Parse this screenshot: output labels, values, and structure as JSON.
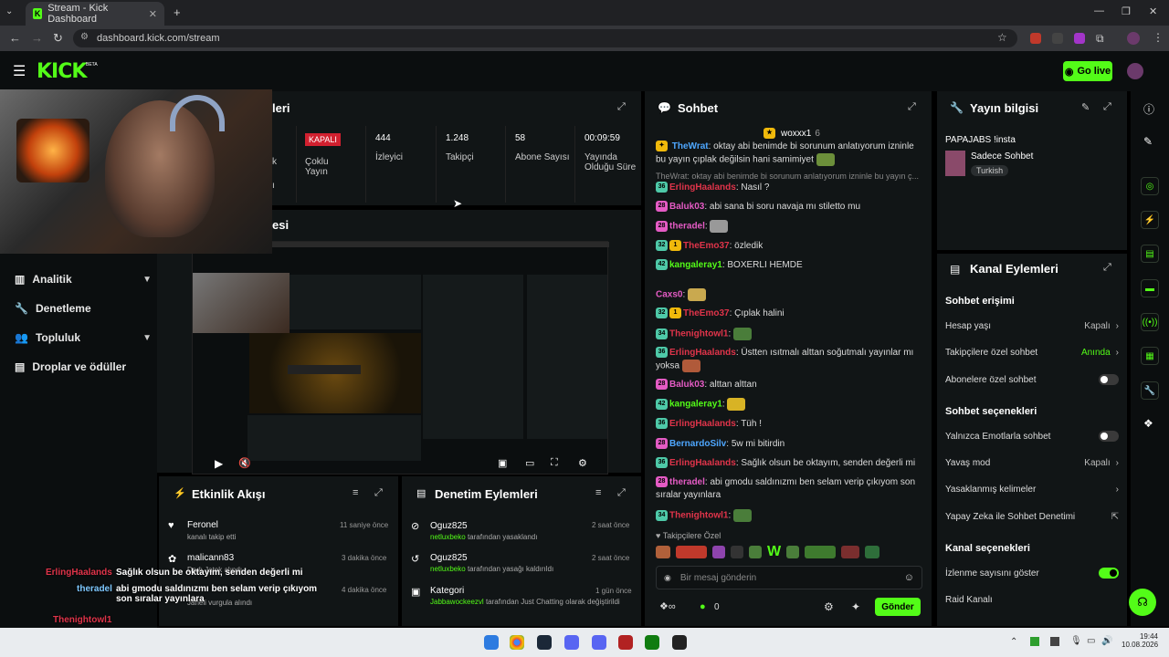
{
  "browser": {
    "tab_title": "Stream - Kick Dashboard",
    "tab_favicon": "K",
    "url": "dashboard.kick.com/stream"
  },
  "header": {
    "logo": "KICK",
    "logo_tag": "BETA",
    "go_live": "Go live"
  },
  "sidebar": {
    "items": [
      {
        "label": "Analitik",
        "icon": "chart-icon",
        "expandable": true
      },
      {
        "label": "Denetleme",
        "icon": "wrench-icon",
        "expandable": false
      },
      {
        "label": "Topluluk",
        "icon": "people-icon",
        "expandable": true
      },
      {
        "label": "Droplar ve ödüller",
        "icon": "gift-icon",
        "expandable": false
      }
    ]
  },
  "stats": {
    "title_partial": "leri",
    "status_label": "KAPALI",
    "partial_labels": [
      "k",
      "ı"
    ],
    "items": [
      {
        "value": "",
        "label": "Çoklu Yayın"
      },
      {
        "value": "444",
        "label": "İzleyici"
      },
      {
        "value": "1.248",
        "label": "Takipçi"
      },
      {
        "value": "58",
        "label": "Abone Sayısı"
      },
      {
        "value": "00:09:59",
        "label": "Yayında Olduğu Süre"
      }
    ]
  },
  "preview": {
    "title_partial": "esi"
  },
  "chat": {
    "title": "Sohbet",
    "pinned_user": "woxxx1",
    "pinned_count": "6",
    "messages": [
      {
        "badge": "",
        "user": "TheWrat",
        "user_color": "#4ea7ff",
        "text": "oktay abi benimde bi sorunum anlatıyorum izninle bu yayın çıplak değilsin hani samimiyet"
      },
      {
        "badge": "",
        "user": "",
        "user_color": "#888888",
        "text": "TheWrat: oktay abi benimde bi sorunum anlatıyorum izninle bu yayın ç..."
      },
      {
        "badge": "36",
        "user": "ErlingHaalands",
        "user_color": "#e0344a",
        "text": "Nasıl ?"
      },
      {
        "badge": "28",
        "user": "Baluk03",
        "user_color": "#e45bc4",
        "text": "abi sana bi soru navaja mı stiletto mu"
      },
      {
        "badge": "28",
        "user": "theradel",
        "user_color": "#e45bc4",
        "text": ""
      },
      {
        "badge": "32",
        "user": "TheEmo37",
        "user_color": "#e0344a",
        "text": "özledik"
      },
      {
        "badge": "42",
        "user": "kangaleray1",
        "user_color": "#53fc18",
        "text": "BOXERLI HEMDE"
      },
      {
        "badge": "",
        "user": "Caxs0",
        "user_color": "#e45bc4",
        "text": ""
      },
      {
        "badge": "32",
        "user": "TheEmo37",
        "user_color": "#e0344a",
        "text": "Çıplak halini"
      },
      {
        "badge": "34",
        "user": "Thenightowl1",
        "user_color": "#e0344a",
        "text": ""
      },
      {
        "badge": "36",
        "user": "ErlingHaalands",
        "user_color": "#e0344a",
        "text": "Üstten ısıtmalı alttan soğutmalı yayınlar mı yoksa"
      },
      {
        "badge": "28",
        "user": "Baluk03",
        "user_color": "#e45bc4",
        "text": "alttan alttan"
      },
      {
        "badge": "42",
        "user": "kangaleray1",
        "user_color": "#53fc18",
        "text": ""
      },
      {
        "badge": "36",
        "user": "ErlingHaalands",
        "user_color": "#e0344a",
        "text": "Tüh !"
      },
      {
        "badge": "28",
        "user": "BernardoSilv",
        "user_color": "#4ea7ff",
        "text": "5w mi bitirdin"
      },
      {
        "badge": "36",
        "user": "ErlingHaalands",
        "user_color": "#e0344a",
        "text": "Sağlık olsun be oktayım, senden değerli mi"
      },
      {
        "badge": "28",
        "user": "theradel",
        "user_color": "#e45bc4",
        "text": "abi gmodu saldınızmı ben selam verip çıkıyom son sıralar yayınlara"
      },
      {
        "badge": "34",
        "user": "Thenightowl1",
        "user_color": "#e0344a",
        "text": ""
      }
    ],
    "followers_only": "Takipçilere Özel",
    "input_placeholder": "Bir mesaj gönderin",
    "points": "0",
    "send": "Gönder"
  },
  "stream_info": {
    "title": "Yayın bilgisi",
    "stream_title": "PAPAJABS !insta",
    "category": "Sadece Sohbet",
    "tag": "Turkish"
  },
  "channel_actions": {
    "title": "Kanal Eylemleri",
    "chat_access_heading": "Sohbet erişimi",
    "account_age": {
      "label": "Hesap yaşı",
      "value": "Kapalı"
    },
    "followers_only": {
      "label": "Takipçilere özel sohbet",
      "value": "Anında"
    },
    "subscribers_only": {
      "label": "Abonelere özel sohbet",
      "on": false
    },
    "chat_options_heading": "Sohbet seçenekleri",
    "emotes_only": {
      "label": "Yalnızca Emotlarla sohbet",
      "on": false
    },
    "slow_mode": {
      "label": "Yavaş mod",
      "value": "Kapalı"
    },
    "banned_words": {
      "label": "Yasaklanmış kelimeler"
    },
    "ai_moderation": {
      "label": "Yapay Zeka ile Sohbet Denetimi"
    },
    "channel_options_heading": "Kanal seçenekleri",
    "show_viewer_count": {
      "label": "İzlenme sayısını göster",
      "on": true
    },
    "raid": {
      "label": "Raid Kanalı"
    }
  },
  "activity": {
    "title": "Etkinlik Akışı",
    "events": [
      {
        "name": "Feronel",
        "sub": "kanalı takip etti",
        "time": "11 saniye önce"
      },
      {
        "name": "malicann83",
        "sub": "Dadı Jatek alındı",
        "time": "3 dakika önce"
      },
      {
        "name": "",
        "sub": "Janeli vurgula alındı",
        "time": "4 dakika önce"
      }
    ]
  },
  "moderation": {
    "title": "Denetim Eylemleri",
    "events": [
      {
        "name": "Oguz825",
        "sub_user": "netluxbeko",
        "sub": "tarafından yasaklandı",
        "time": "2 saat önce"
      },
      {
        "name": "Oguz825",
        "sub_user": "netluxbeko",
        "sub": "tarafından yasağı kaldırıldı",
        "time": "2 saat önce"
      },
      {
        "name": "Kategori",
        "sub_user": "Jabbawockeezvl",
        "sub": "tarafından Just Chatting olarak değiştirildi",
        "time": "1 gün önce"
      }
    ]
  },
  "overlay_chat": [
    {
      "user": "ErlingHaalands",
      "color": "#e0344a",
      "text": "Sağlık olsun be oktayım, senden değerli mi"
    },
    {
      "user": "theradel",
      "color": "#7ec8ff",
      "text": "abi gmodu saldınızmı ben selam verip çıkıyom son sıralar yayınlara"
    },
    {
      "user": "Thenightowl1",
      "color": "#e0344a",
      "text": ""
    }
  ],
  "clock": {
    "time": "19:44",
    "date": "10.08.2026"
  },
  "colors": {
    "brand": "#53fc18",
    "panel": "#111516",
    "status_red": "#d1202f"
  }
}
